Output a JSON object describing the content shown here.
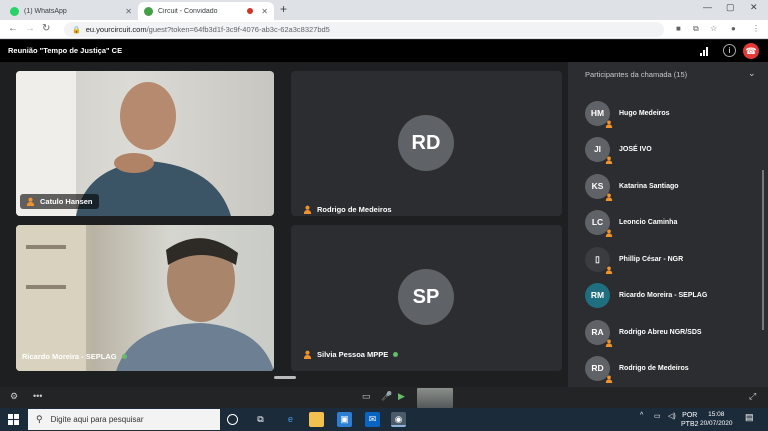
{
  "browser": {
    "tabs": [
      {
        "label": "(1) WhatsApp",
        "favicon_color": "#25d366",
        "active": false
      },
      {
        "label": "Circuit - Convidado",
        "favicon_color": "#43a047",
        "active": true
      }
    ],
    "new_tab_symbol": "+",
    "url_host": "eu.yourcircuit.com",
    "url_path": "/guest?token=64fb3d1f-3c9f-4076-ab3c-62a3c8327bd5"
  },
  "meeting": {
    "title": "Reunião \"Tempo de Justiça\" CE"
  },
  "stage": {
    "tiles": [
      {
        "name": "Catulo Hansen",
        "initials": "",
        "video": true,
        "green_dot": false
      },
      {
        "name": "Rodrigo de Medeiros",
        "initials": "RD",
        "video": false,
        "green_dot": false
      },
      {
        "name": "Ricardo Moreira - SEPLAG",
        "initials": "",
        "video": true,
        "green_dot": true
      },
      {
        "name": "Silvia Pessoa MPPE",
        "initials": "SP",
        "video": false,
        "green_dot": true
      }
    ]
  },
  "sidebar": {
    "header": "Participantes da chamada (15)",
    "participants": [
      {
        "initials": "HM",
        "name": "Hugo Medeiros",
        "avatar_color": "#5f6266"
      },
      {
        "initials": "JI",
        "name": "JOSÉ IVO",
        "avatar_color": "#5f6266"
      },
      {
        "initials": "KS",
        "name": "Katarina Santiago",
        "avatar_color": "#5f6266"
      },
      {
        "initials": "LC",
        "name": "Leoncio Caminha",
        "avatar_color": "#5f6266"
      },
      {
        "initials": "",
        "name": "Phillip César - NGR",
        "avatar_color": "#3a3c3f"
      },
      {
        "initials": "RM",
        "name": "Ricardo Moreira - SEPLAG",
        "avatar_color": "#1f6f80"
      },
      {
        "initials": "RA",
        "name": "Rodrigo Abreu NGR/SDS",
        "avatar_color": "#5f6266"
      },
      {
        "initials": "RD",
        "name": "Rodrigo de Medeiros",
        "avatar_color": "#5f6266"
      }
    ]
  },
  "taskbar": {
    "search_placeholder": "Digite aqui para pesquisar",
    "lang_top": "POR",
    "lang_bottom": "PTB2",
    "time": "15:08",
    "date": "20/07/2020"
  },
  "colors": {
    "accent_orange": "#f0932b",
    "hangup_red": "#e53935",
    "online_green": "#66bb6a"
  }
}
